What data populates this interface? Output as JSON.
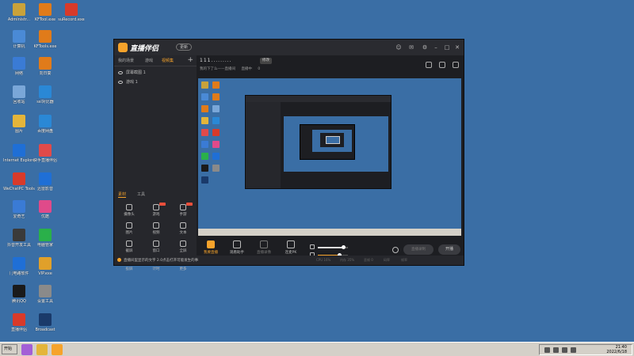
{
  "desktop_icons": [
    {
      "label": "Administr...",
      "color": "#c9a23a"
    },
    {
      "label": "KFTool.exe",
      "color": "#e07b1a"
    },
    {
      "label": "suRecord.exe",
      "color": "#d83a2a"
    },
    {
      "label": "计算机",
      "color": "#4a8ad6"
    },
    {
      "label": "KFTools.exe",
      "color": "#e07b1a"
    },
    {
      "label": "网络",
      "color": "#3a7bd5"
    },
    {
      "label": "向日葵",
      "color": "#e07b1a"
    },
    {
      "label": "回收站",
      "color": "#7aa7d8"
    },
    {
      "label": "ssl对比器",
      "color": "#2a88d6"
    },
    {
      "label": "图片",
      "color": "#e4b53a"
    },
    {
      "label": "百度网盘",
      "color": "#2a88d6"
    },
    {
      "label": "Internet Explorer",
      "color": "#1f6fd6"
    },
    {
      "label": "快手直播伴侣",
      "color": "#e04a4a"
    },
    {
      "label": "WeChatPC Tools",
      "color": "#d83a2a"
    },
    {
      "label": "迅雷影音",
      "color": "#1f6fd6"
    },
    {
      "label": "爱奇艺",
      "color": "#3a7bd5"
    },
    {
      "label": "优酷",
      "color": "#e04a8a"
    },
    {
      "label": "抖音开发工具",
      "color": "#3a3a3a"
    },
    {
      "label": "电脑管家",
      "color": "#2ab04a"
    },
    {
      "label": "门电路软件",
      "color": "#1f6fd6"
    },
    {
      "label": "VIP.exe",
      "color": "#e0a02a"
    },
    {
      "label": "腾讯QQ",
      "color": "#1a1a1a"
    },
    {
      "label": "设置工具",
      "color": "#8a8a8a"
    },
    {
      "label": "直播伴侣",
      "color": "#d83a2a"
    },
    {
      "label": "Broadcast",
      "color": "#1a3a6a"
    }
  ],
  "taskbar": {
    "start_label": "开始",
    "time": "21:40",
    "date": "2022/6/18",
    "apps": [
      "#a35fd6",
      "#e4b53a",
      "#f6a32b"
    ]
  },
  "app": {
    "title": "直播伴侣",
    "badge": "更新",
    "tabs": [
      "我的场景",
      "游戏",
      "视频集"
    ],
    "active_tab_index": 2,
    "scenes": [
      "屏幕截图 1",
      "游戏 1"
    ],
    "section_tabs": [
      "素材",
      "工具"
    ],
    "tools": [
      {
        "label": "摄像头",
        "hot": false
      },
      {
        "label": "游戏",
        "hot": true
      },
      {
        "label": "手游",
        "hot": true
      },
      {
        "label": "图片",
        "hot": false
      },
      {
        "label": "视频",
        "hot": false
      },
      {
        "label": "文本",
        "hot": false
      },
      {
        "label": "截屏",
        "hot": false
      },
      {
        "label": "窗口",
        "hot": false
      },
      {
        "label": "全屏",
        "hot": false
      },
      {
        "label": "投屏",
        "hot": false
      },
      {
        "label": "计时",
        "hot": false
      },
      {
        "label": "更多",
        "hot": false
      }
    ],
    "room": {
      "title": "111.........",
      "edit_label": "修改",
      "sub": [
        "我的下了么——直播间",
        "直播中",
        "0"
      ]
    },
    "controls": [
      {
        "label": "我要直播",
        "state": "active"
      },
      {
        "label": "观看助手",
        "state": "normal"
      },
      {
        "label": "直播录像",
        "state": "disabled"
      },
      {
        "label": "连麦PK",
        "state": "normal"
      }
    ],
    "mic_level": 0.85,
    "speaker_level": 0.7,
    "record_label": "直播录制",
    "live_label": "开播",
    "footer_text": "直播间里显示的文字 2.0点击打开可能发生的事",
    "footer_stats": [
      "CPU 16%",
      "内存 35%",
      "丢帧 0",
      "码率",
      "帧率"
    ]
  }
}
